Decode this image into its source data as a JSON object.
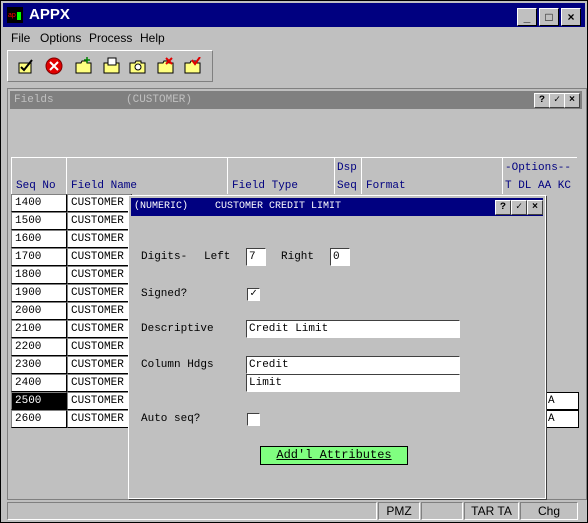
{
  "window": {
    "title": "APPX",
    "minimize": "_",
    "maximize": "□",
    "close": "×"
  },
  "menu": [
    "File",
    "Options",
    "Process",
    "Help"
  ],
  "toolbar_icons": [
    "check-icon",
    "stop-icon",
    "folder-add-icon",
    "folder-edit-icon",
    "folder-search-icon",
    "folder-delete-icon",
    "folder-check-icon"
  ],
  "fields_window": {
    "title": "Fields",
    "context": "(CUSTOMER)",
    "help": "?",
    "ok": "✓",
    "close": "×"
  },
  "grid": {
    "headers": {
      "seq": "Seq No",
      "name": "Field Name",
      "type": "Field Type",
      "dsp1": "Dsp",
      "dsp2": "Seq",
      "format": "Format",
      "options": "-Options--",
      "optcols": "T DL AA KC"
    },
    "rows": [
      {
        "seq": "1400",
        "name": "CUSTOMER"
      },
      {
        "seq": "1500",
        "name": "CUSTOMER"
      },
      {
        "seq": "1600",
        "name": "CUSTOMER"
      },
      {
        "seq": "1700",
        "name": "CUSTOMER"
      },
      {
        "seq": "1800",
        "name": "CUSTOMER"
      },
      {
        "seq": "1900",
        "name": "CUSTOMER"
      },
      {
        "seq": "2000",
        "name": "CUSTOMER"
      },
      {
        "seq": "2100",
        "name": "CUSTOMER"
      },
      {
        "seq": "2200",
        "name": "CUSTOMER"
      },
      {
        "seq": "2300",
        "name": "CUSTOMER"
      },
      {
        "seq": "2400",
        "name": "CUSTOMER"
      },
      {
        "seq": "2500",
        "name": "CUSTOMER",
        "aa": "A",
        "selected": true
      },
      {
        "seq": "2600",
        "name": "CUSTOMER",
        "aa": "A"
      }
    ]
  },
  "dialog": {
    "type": "(NUMERIC)",
    "title": "CUSTOMER CREDIT LIMIT",
    "help": "?",
    "ok": "✓",
    "close": "×",
    "digits_label": "Digits-",
    "left_label": "Left",
    "left_value": "7",
    "right_label": "Right",
    "right_value": "0",
    "signed_label": "Signed?",
    "signed_checked": true,
    "descriptive_label": "Descriptive",
    "descriptive_value": "Credit Limit",
    "column_hdgs_label": "Column Hdgs",
    "hdg1": "Credit",
    "hdg2": "Limit",
    "auto_seq_label": "Auto seq?",
    "auto_seq_checked": false,
    "attr_button": "Add'l Attributes"
  },
  "status_bar": {
    "pane1": "",
    "pane2": "PMZ",
    "pane3": "",
    "pane4": "TAR TA",
    "pane5": "Chg"
  }
}
